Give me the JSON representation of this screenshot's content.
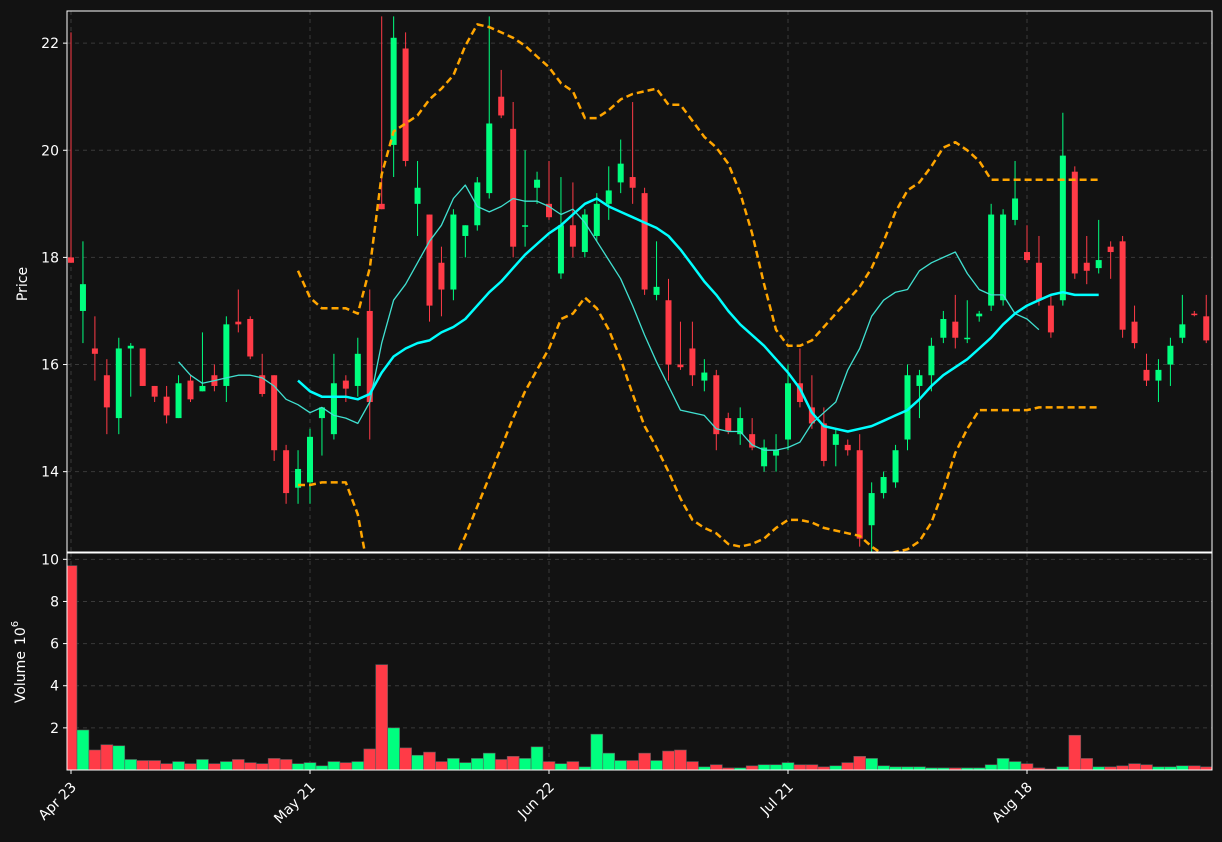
{
  "chart_data": {
    "type": "candlestick",
    "colors": {
      "background": "#121212",
      "up": "#00ff7f",
      "down": "#ff3b47",
      "bollinger": "#ffa500",
      "sma_long": "#00ffff",
      "sma_short": "#40e0d0",
      "grid": "#3a3a3a",
      "axis": "#ffffff"
    },
    "price_panel": {
      "ylabel": "Price",
      "ylim": [
        12.5,
        22.6
      ],
      "yticks": [
        "14",
        "16",
        "18",
        "20",
        "22"
      ],
      "grid": true
    },
    "volume_panel": {
      "ylabel": "Volume",
      "ylabel_unit": "10",
      "ylabel_exp": "6",
      "ylim": [
        0,
        10.3
      ],
      "yticks": [
        "2",
        "4",
        "6",
        "8",
        "10"
      ],
      "grid": true
    },
    "x_axis": {
      "type": "date",
      "ticks": [
        {
          "label": "Apr 23",
          "index": 0
        },
        {
          "label": "May 21",
          "index": 20
        },
        {
          "label": "Jun 22",
          "index": 40
        },
        {
          "label": "Jul 21",
          "index": 60
        },
        {
          "label": "Aug 18",
          "index": 80
        }
      ]
    },
    "ohlc": [
      [
        18.0,
        22.2,
        17.9,
        17.9
      ],
      [
        17.0,
        18.3,
        16.4,
        17.5
      ],
      [
        16.3,
        16.9,
        15.7,
        16.2
      ],
      [
        15.8,
        16.1,
        14.7,
        15.2
      ],
      [
        15.0,
        16.5,
        14.7,
        16.3
      ],
      [
        16.3,
        16.4,
        15.4,
        16.35
      ],
      [
        16.3,
        16.3,
        15.6,
        15.6
      ],
      [
        15.6,
        15.6,
        15.3,
        15.4
      ],
      [
        15.4,
        15.6,
        14.9,
        15.05
      ],
      [
        15.0,
        15.8,
        15.0,
        15.65
      ],
      [
        15.7,
        15.8,
        15.3,
        15.35
      ],
      [
        15.5,
        16.6,
        15.5,
        15.6
      ],
      [
        15.8,
        16.0,
        15.5,
        15.6
      ],
      [
        15.6,
        16.9,
        15.3,
        16.75
      ],
      [
        16.8,
        17.4,
        16.6,
        16.75
      ],
      [
        16.85,
        16.9,
        16.1,
        16.15
      ],
      [
        15.8,
        16.2,
        15.4,
        15.45
      ],
      [
        15.8,
        15.8,
        14.2,
        14.4
      ],
      [
        14.4,
        14.5,
        13.4,
        13.6
      ],
      [
        13.7,
        14.4,
        13.4,
        14.05
      ],
      [
        13.8,
        14.8,
        13.4,
        14.65
      ],
      [
        15.0,
        15.2,
        14.3,
        15.2
      ],
      [
        14.7,
        16.2,
        14.6,
        15.65
      ],
      [
        15.7,
        15.8,
        15.3,
        15.55
      ],
      [
        15.6,
        16.5,
        15.4,
        16.2
      ],
      [
        17.0,
        17.4,
        14.6,
        15.3
      ],
      [
        19.0,
        22.5,
        18.9,
        18.9
      ],
      [
        20.1,
        22.5,
        19.5,
        22.1
      ],
      [
        21.9,
        22.2,
        19.7,
        19.8
      ],
      [
        19.0,
        19.8,
        18.4,
        19.3
      ],
      [
        18.8,
        18.8,
        16.8,
        17.1
      ],
      [
        17.9,
        18.2,
        16.9,
        17.4
      ],
      [
        17.4,
        18.9,
        17.2,
        18.8
      ],
      [
        18.4,
        18.6,
        18.0,
        18.6
      ],
      [
        18.6,
        19.5,
        18.5,
        19.4
      ],
      [
        19.2,
        22.5,
        19.1,
        20.5
      ],
      [
        21.0,
        21.5,
        20.6,
        20.65
      ],
      [
        20.4,
        20.9,
        18.0,
        18.2
      ],
      [
        18.6,
        20.0,
        18.2,
        18.6
      ],
      [
        19.3,
        19.6,
        19.0,
        19.45
      ],
      [
        19.0,
        19.8,
        18.7,
        18.75
      ],
      [
        17.7,
        19.5,
        17.6,
        18.6
      ],
      [
        18.6,
        19.4,
        18.0,
        18.2
      ],
      [
        18.1,
        18.9,
        18.0,
        18.8
      ],
      [
        18.4,
        19.2,
        18.3,
        19.0
      ],
      [
        19.0,
        19.7,
        18.7,
        19.25
      ],
      [
        19.4,
        20.2,
        19.2,
        19.75
      ],
      [
        19.5,
        20.9,
        19.0,
        19.3
      ],
      [
        19.2,
        19.3,
        17.3,
        17.4
      ],
      [
        17.3,
        18.3,
        17.2,
        17.45
      ],
      [
        17.2,
        17.6,
        15.7,
        16.0
      ],
      [
        16.0,
        16.8,
        15.9,
        15.95
      ],
      [
        16.3,
        16.8,
        15.6,
        15.8
      ],
      [
        15.7,
        16.1,
        15.5,
        15.85
      ],
      [
        15.8,
        15.9,
        14.4,
        14.7
      ],
      [
        15.0,
        15.1,
        14.7,
        14.75
      ],
      [
        14.7,
        15.2,
        14.5,
        15.0
      ],
      [
        14.7,
        15.0,
        14.4,
        14.45
      ],
      [
        14.1,
        14.6,
        14.0,
        14.45
      ],
      [
        14.3,
        14.7,
        14.0,
        14.4
      ],
      [
        14.6,
        16.0,
        14.4,
        15.65
      ],
      [
        15.65,
        16.3,
        15.2,
        15.3
      ],
      [
        15.2,
        15.8,
        14.8,
        14.9
      ],
      [
        14.9,
        15.2,
        14.1,
        14.2
      ],
      [
        14.5,
        14.8,
        14.1,
        14.7
      ],
      [
        14.5,
        14.6,
        14.3,
        14.4
      ],
      [
        14.4,
        14.7,
        12.6,
        12.75
      ],
      [
        13.0,
        13.8,
        12.5,
        13.6
      ],
      [
        13.6,
        14.0,
        13.5,
        13.9
      ],
      [
        13.8,
        14.5,
        13.7,
        14.4
      ],
      [
        14.6,
        16.0,
        14.4,
        15.8
      ],
      [
        15.6,
        15.9,
        15.0,
        15.8
      ],
      [
        15.8,
        16.5,
        15.5,
        16.35
      ],
      [
        16.5,
        17.0,
        16.4,
        16.85
      ],
      [
        16.8,
        17.3,
        16.3,
        16.5
      ],
      [
        16.5,
        17.2,
        16.4,
        16.5
      ],
      [
        16.9,
        17.0,
        16.8,
        16.95
      ],
      [
        17.1,
        19.0,
        17.0,
        18.8
      ],
      [
        17.2,
        18.9,
        17.1,
        18.8
      ],
      [
        18.7,
        19.8,
        18.6,
        19.1
      ],
      [
        18.1,
        18.6,
        17.9,
        17.95
      ],
      [
        17.9,
        18.4,
        17.1,
        17.2
      ],
      [
        17.1,
        17.3,
        16.5,
        16.6
      ],
      [
        17.2,
        20.7,
        17.1,
        19.9
      ],
      [
        19.6,
        19.7,
        17.6,
        17.7
      ],
      [
        17.9,
        18.4,
        17.5,
        17.75
      ],
      [
        17.8,
        18.7,
        17.7,
        17.95
      ],
      [
        18.2,
        18.3,
        17.6,
        18.1
      ],
      [
        18.3,
        18.4,
        16.5,
        16.65
      ],
      [
        16.8,
        17.1,
        16.3,
        16.4
      ],
      [
        15.9,
        16.2,
        15.6,
        15.7
      ],
      [
        15.7,
        16.1,
        15.3,
        15.9
      ],
      [
        16.0,
        16.5,
        15.6,
        16.35
      ],
      [
        16.5,
        17.3,
        16.4,
        16.75
      ],
      [
        16.95,
        17.0,
        16.9,
        16.93
      ],
      [
        16.9,
        17.3,
        16.4,
        16.45
      ]
    ],
    "volume": [
      9.7,
      1.9,
      0.95,
      1.2,
      1.15,
      0.5,
      0.45,
      0.45,
      0.3,
      0.4,
      0.3,
      0.5,
      0.3,
      0.4,
      0.5,
      0.35,
      0.3,
      0.55,
      0.5,
      0.3,
      0.35,
      0.2,
      0.4,
      0.35,
      0.4,
      1.0,
      5.0,
      2.0,
      1.05,
      0.7,
      0.85,
      0.4,
      0.55,
      0.35,
      0.55,
      0.8,
      0.5,
      0.65,
      0.55,
      1.1,
      0.4,
      0.3,
      0.4,
      0.15,
      1.7,
      0.8,
      0.45,
      0.45,
      0.8,
      0.45,
      0.9,
      0.95,
      0.4,
      0.15,
      0.25,
      0.1,
      0.1,
      0.2,
      0.25,
      0.25,
      0.35,
      0.25,
      0.25,
      0.15,
      0.2,
      0.35,
      0.65,
      0.55,
      0.2,
      0.15,
      0.15,
      0.15,
      0.1,
      0.1,
      0.1,
      0.1,
      0.1,
      0.25,
      0.55,
      0.4,
      0.3,
      0.1,
      0.05,
      0.15,
      1.65,
      0.55,
      0.15,
      0.15,
      0.2,
      0.3,
      0.25,
      0.15,
      0.15,
      0.2,
      0.2,
      0.15,
      0.2,
      0.15
    ],
    "overlays": {
      "sma_short_start": 9,
      "sma_short": [
        16.05,
        15.8,
        15.65,
        15.7,
        15.75,
        15.8,
        15.8,
        15.75,
        15.6,
        15.35,
        15.25,
        15.1,
        15.2,
        15.05,
        15.0,
        14.9,
        15.3,
        16.4,
        17.2,
        17.5,
        17.9,
        18.3,
        18.6,
        19.1,
        19.35,
        18.95,
        18.85,
        18.95,
        19.1,
        19.05,
        19.05,
        18.95,
        18.8,
        18.9,
        18.65,
        18.3,
        17.95,
        17.6,
        17.1,
        16.55,
        16.05,
        15.6,
        15.15,
        15.1,
        15.05,
        14.8,
        14.75,
        14.75,
        14.5,
        14.4,
        14.4,
        14.45,
        14.55,
        14.9,
        15.1,
        15.3,
        15.9,
        16.3,
        16.9,
        17.2,
        17.35,
        17.4,
        17.75,
        17.9,
        18.0,
        18.1,
        17.7,
        17.4,
        17.3,
        17.3,
        16.95,
        16.85,
        16.65
      ],
      "sma_long_start": 19,
      "sma_long": [
        15.7,
        15.5,
        15.4,
        15.4,
        15.4,
        15.35,
        15.45,
        15.85,
        16.15,
        16.3,
        16.4,
        16.45,
        16.6,
        16.7,
        16.85,
        17.1,
        17.35,
        17.55,
        17.8,
        18.05,
        18.25,
        18.45,
        18.6,
        18.8,
        19.0,
        19.1,
        18.95,
        18.85,
        18.75,
        18.65,
        18.55,
        18.4,
        18.15,
        17.85,
        17.55,
        17.3,
        17.0,
        16.75,
        16.55,
        16.35,
        16.1,
        15.85,
        15.55,
        15.1,
        14.85,
        14.8,
        14.75,
        14.8,
        14.85,
        14.95,
        15.05,
        15.15,
        15.35,
        15.6,
        15.8,
        15.95,
        16.1,
        16.3,
        16.5,
        16.75,
        16.95,
        17.1,
        17.2,
        17.3,
        17.35,
        17.3,
        17.3,
        17.3
      ],
      "bb_start": 19,
      "bb_upper": [
        17.75,
        17.25,
        17.05,
        17.05,
        17.05,
        16.95,
        17.8,
        19.55,
        20.35,
        20.5,
        20.65,
        20.95,
        21.15,
        21.4,
        21.95,
        22.35,
        22.3,
        22.2,
        22.1,
        21.95,
        21.75,
        21.55,
        21.25,
        21.1,
        20.6,
        20.6,
        20.75,
        20.95,
        21.05,
        21.1,
        21.15,
        20.85,
        20.85,
        20.55,
        20.25,
        20.05,
        19.75,
        19.2,
        18.45,
        17.5,
        16.65,
        16.35,
        16.35,
        16.45,
        16.7,
        16.95,
        17.2,
        17.45,
        17.8,
        18.3,
        18.85,
        19.25,
        19.4,
        19.7,
        20.05,
        20.15,
        20.0,
        19.8,
        19.45,
        19.45,
        19.45,
        19.45,
        19.45,
        19.45,
        19.45,
        19.45,
        19.45,
        19.45
      ],
      "bb_lower": [
        13.75,
        13.75,
        13.8,
        13.8,
        13.8,
        13.2,
        12.0,
        11.0,
        10.8,
        10.8,
        10.9,
        11.3,
        11.8,
        12.3,
        12.8,
        13.35,
        13.9,
        14.45,
        15.0,
        15.5,
        15.9,
        16.3,
        16.85,
        16.95,
        17.25,
        17.05,
        16.65,
        16.1,
        15.45,
        14.85,
        14.45,
        14.0,
        13.5,
        13.1,
        12.95,
        12.85,
        12.65,
        12.6,
        12.65,
        12.75,
        12.95,
        13.1,
        13.1,
        13.05,
        12.95,
        12.9,
        12.85,
        12.8,
        12.6,
        12.45,
        12.5,
        12.55,
        12.7,
        13.05,
        13.65,
        14.35,
        14.8,
        15.15,
        15.15,
        15.15,
        15.15,
        15.15,
        15.2,
        15.2,
        15.2,
        15.2,
        15.2,
        15.2
      ]
    }
  }
}
